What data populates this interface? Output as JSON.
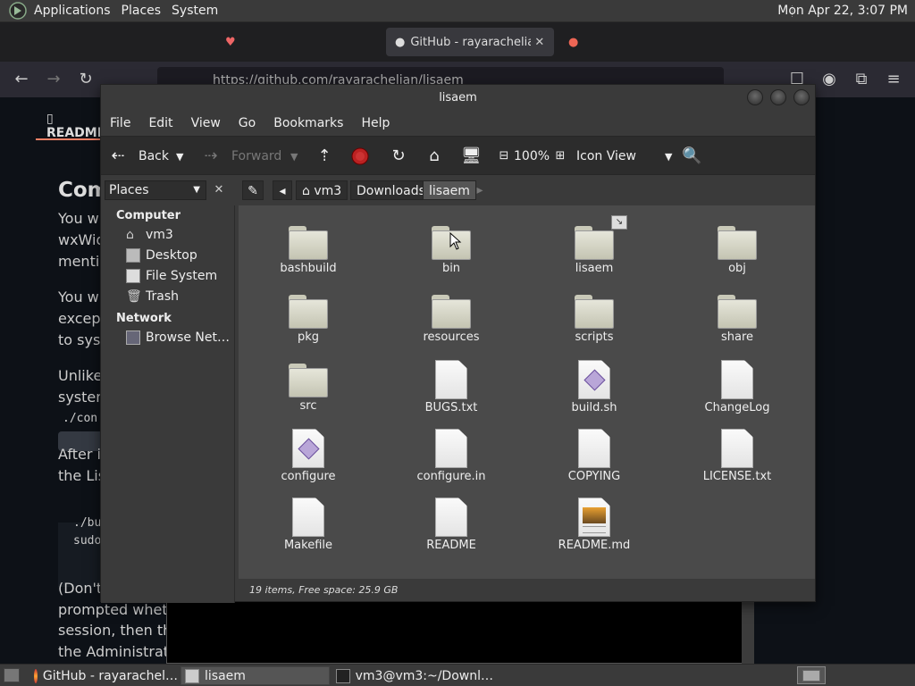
{
  "top_panel": {
    "menus": [
      "Applications",
      "Places",
      "System"
    ],
    "clock": "Mon Apr 22,  3:07 PM"
  },
  "browser": {
    "tabs": [
      {
        "label": "",
        "active": false
      },
      {
        "label": "",
        "active": false
      },
      {
        "label": "GitHub - rayarachelian",
        "active": true
      },
      {
        "label": "",
        "active": false
      }
    ],
    "url": "https://github.com/rayarachelian/lisaem",
    "readme_tab": "README",
    "heading": "Com",
    "text_lines": [
      "You wi",
      "wxWid",
      "mentio",
      "You wi",
      "except",
      "to syst",
      "Unlike",
      "system",
      "After in",
      "the Lis",
      "(Don't",
      "prompted whethe",
      "session, then the",
      "the Administrato"
    ],
    "code_lines": [
      "./con",
      "./bu",
      "sudo"
    ]
  },
  "file_manager": {
    "title": "lisaem",
    "menus": [
      "File",
      "Edit",
      "View",
      "Go",
      "Bookmarks",
      "Help"
    ],
    "toolbar": {
      "back": "Back",
      "forward": "Forward",
      "zoom": "100%",
      "view_mode": "Icon View"
    },
    "sidebar_selector": "Places",
    "breadcrumbs": [
      "vm3",
      "Downloads",
      "lisaem"
    ],
    "sidebar": {
      "computer_heading": "Computer",
      "computer_items": [
        "vm3",
        "Desktop",
        "File System",
        "Trash"
      ],
      "network_heading": "Network",
      "network_items": [
        "Browse Net…"
      ]
    },
    "items": [
      {
        "name": "bashbuild",
        "type": "folder"
      },
      {
        "name": "bin",
        "type": "folder"
      },
      {
        "name": "lisaem",
        "type": "folder-link"
      },
      {
        "name": "obj",
        "type": "folder"
      },
      {
        "name": "pkg",
        "type": "folder"
      },
      {
        "name": "resources",
        "type": "folder"
      },
      {
        "name": "scripts",
        "type": "folder"
      },
      {
        "name": "share",
        "type": "folder"
      },
      {
        "name": "src",
        "type": "folder"
      },
      {
        "name": "BUGS.txt",
        "type": "text"
      },
      {
        "name": "build.sh",
        "type": "script"
      },
      {
        "name": "ChangeLog",
        "type": "text"
      },
      {
        "name": "configure",
        "type": "script"
      },
      {
        "name": "configure.in",
        "type": "text"
      },
      {
        "name": "COPYING",
        "type": "text"
      },
      {
        "name": "LICENSE.txt",
        "type": "text"
      },
      {
        "name": "Makefile",
        "type": "text"
      },
      {
        "name": "README",
        "type": "text"
      },
      {
        "name": "README.md",
        "type": "image-doc"
      }
    ],
    "status": "19 items, Free space: 25.9 GB"
  },
  "taskbar": {
    "tasks": [
      {
        "label": "GitHub - rayarachel…",
        "active": false
      },
      {
        "label": "lisaem",
        "active": true
      },
      {
        "label": "vm3@vm3:~/Downl…",
        "active": false
      }
    ]
  }
}
